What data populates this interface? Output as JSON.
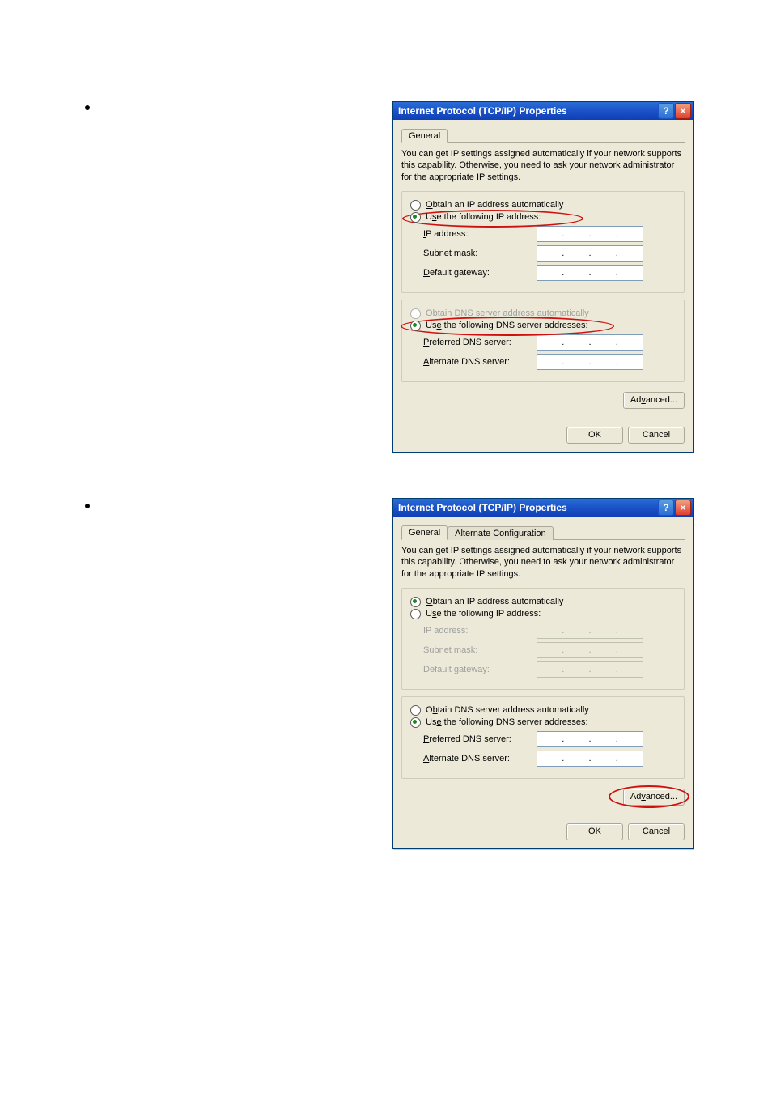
{
  "dialog": {
    "title": "Internet Protocol (TCP/IP) Properties",
    "help_glyph": "?",
    "close_glyph": "×",
    "tabs": {
      "general": "General",
      "alternate": "Alternate Configuration"
    },
    "intro": "You can get IP settings assigned automatically if your network supports this capability. Otherwise, you need to ask your network administrator for the appropriate IP settings.",
    "ip": {
      "obtain_auto": "Obtain an IP address automatically",
      "use_following": "Use the following IP address:",
      "ip_address": "IP address:",
      "subnet_mask": "Subnet mask:",
      "default_gateway": "Default gateway:"
    },
    "dns": {
      "obtain_auto": "Obtain DNS server address automatically",
      "use_following": "Use the following DNS server addresses:",
      "preferred": "Preferred DNS server:",
      "alternate": "Alternate DNS server:"
    },
    "buttons": {
      "advanced": "Advanced...",
      "ok": "OK",
      "cancel": "Cancel"
    }
  }
}
